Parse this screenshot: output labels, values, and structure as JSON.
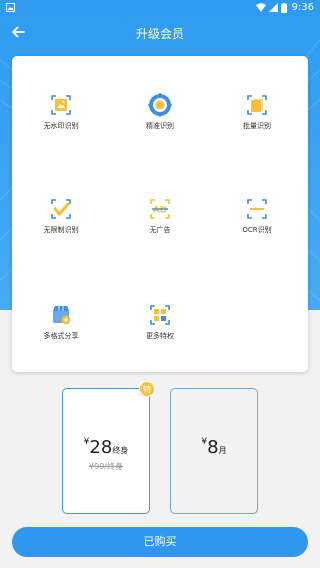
{
  "status_bar": {
    "time": "9:36"
  },
  "app_bar": {
    "title": "升级会员"
  },
  "features": [
    {
      "label": "无水印识别",
      "icon": "no-watermark-icon"
    },
    {
      "label": "精准识别",
      "icon": "target-icon"
    },
    {
      "label": "批量识别",
      "icon": "batch-icon"
    },
    {
      "label": "无限制识别",
      "icon": "unlimited-icon"
    },
    {
      "label": "无广告",
      "icon": "no-ads-icon"
    },
    {
      "label": "OCR识别",
      "icon": "ocr-icon"
    },
    {
      "label": "多格式分享",
      "icon": "share-formats-icon"
    },
    {
      "label": "更多特权",
      "icon": "more-privileges-icon"
    }
  ],
  "plans": [
    {
      "currency": "¥",
      "price": "28",
      "unit": "终身",
      "original": "¥99/终身",
      "selected": true
    },
    {
      "currency": "¥",
      "price": "8",
      "unit": "月",
      "selected": false
    }
  ],
  "badge": {
    "text": "特"
  },
  "buy_button": {
    "label": "已购买"
  },
  "colors": {
    "primary": "#2f97ee",
    "badge": "#f7c241",
    "icon_gold": "#f5c13b",
    "icon_blue": "#3d8fe0"
  }
}
